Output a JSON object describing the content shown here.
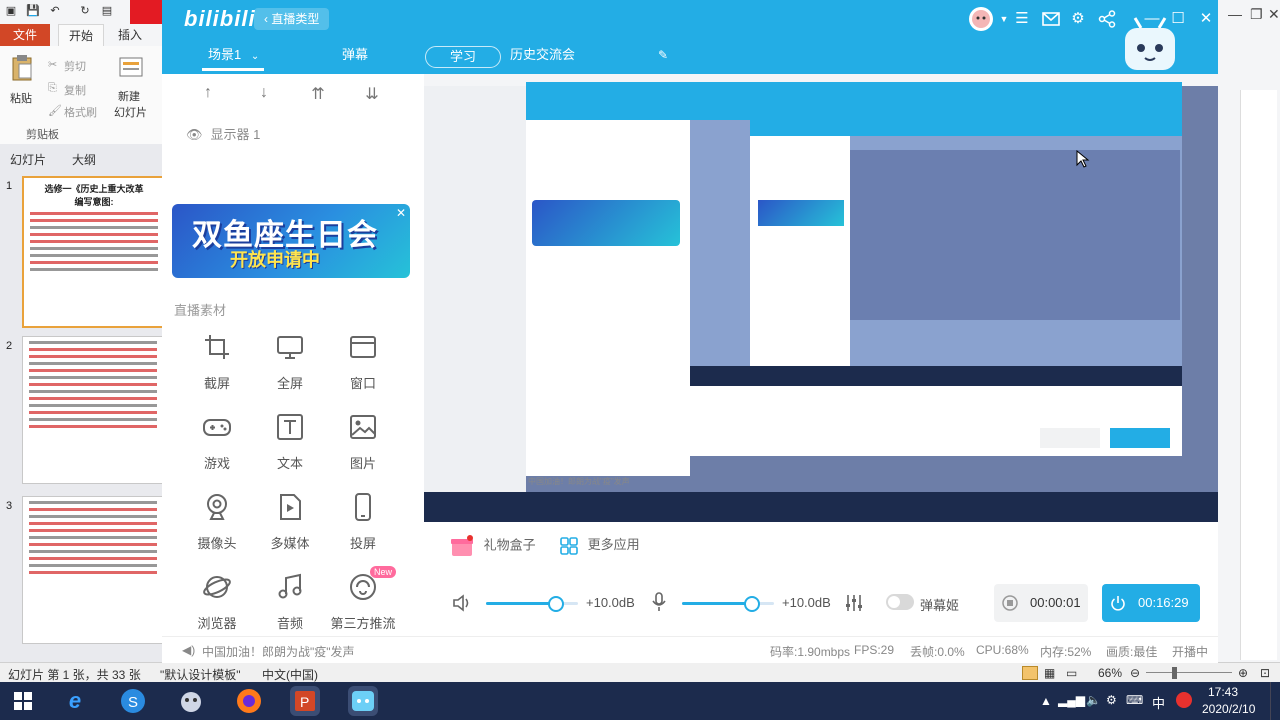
{
  "ppt": {
    "tabs": [
      "文件",
      "开始",
      "插入"
    ],
    "clipboard": {
      "paste": "粘贴",
      "cut": "剪切",
      "copy": "复制",
      "format_painter": "格式刷",
      "group": "剪贴板"
    },
    "new_slide": [
      "新建",
      "幻灯片"
    ],
    "panel_tabs": [
      "幻灯片",
      "大纲"
    ],
    "slide_numbers": [
      "1",
      "2",
      "3"
    ],
    "slide1_title": "选修一《历史上重大改革",
    "slide1_subtitle": "编写意图:",
    "status": {
      "slide_info": "幻灯片 第 1 张，共 33 张",
      "theme": "\"默认设计模板\"",
      "language": "中文(中国)",
      "zoom": "66%"
    }
  },
  "bilibili": {
    "logo": "bilibili",
    "live_type_button": "直播类型",
    "scene_tab": "场景1",
    "tabs": {
      "danmaku": "弹幕",
      "study": "学习",
      "topic": "历史交流会"
    },
    "source_name": "显示器 1",
    "banner": {
      "line1": "双鱼座生日会",
      "line2": "开放申请中"
    },
    "materials_title": "直播素材",
    "tools": [
      {
        "label": "截屏",
        "icon": "crop-icon"
      },
      {
        "label": "全屏",
        "icon": "monitor-icon"
      },
      {
        "label": "窗口",
        "icon": "window-icon"
      },
      {
        "label": "游戏",
        "icon": "gamepad-icon"
      },
      {
        "label": "文本",
        "icon": "text-icon"
      },
      {
        "label": "图片",
        "icon": "image-icon"
      },
      {
        "label": "摄像头",
        "icon": "camera-icon"
      },
      {
        "label": "多媒体",
        "icon": "media-icon"
      },
      {
        "label": "投屏",
        "icon": "phone-icon"
      },
      {
        "label": "浏览器",
        "icon": "browser-icon"
      },
      {
        "label": "音频",
        "icon": "music-icon"
      },
      {
        "label": "第三方推流",
        "icon": "stream-icon",
        "badge": "New"
      }
    ],
    "gift_box": "礼物盒子",
    "more_apps": "更多应用",
    "speaker_volume": "+10.0dB",
    "speaker_level": 0.76,
    "mic_volume": "+10.0dB",
    "mic_level": 0.76,
    "danmaku_ji": "弹幕姬",
    "record_time": "00:00:01",
    "live_time": "00:16:29",
    "announcement": "中国加油！郎朗为战\"疫\"发声",
    "stats": {
      "bitrate": "码率:1.90mbps",
      "fps": "FPS:29",
      "drop": "丢帧:0.0%",
      "cpu": "CPU:68%",
      "memory": "内存:52%",
      "quality": "画质:最佳",
      "live_state": "开播中"
    },
    "preview_caption": "中国加油！郎朗为战\"疫\"发声"
  },
  "taskbar": {
    "time": "17:43",
    "date": "2020/2/10",
    "ime": "中"
  },
  "colors": {
    "bili_blue": "#23ade5",
    "ppt_red": "#d24726",
    "taskbar": "#1c2b4d"
  }
}
